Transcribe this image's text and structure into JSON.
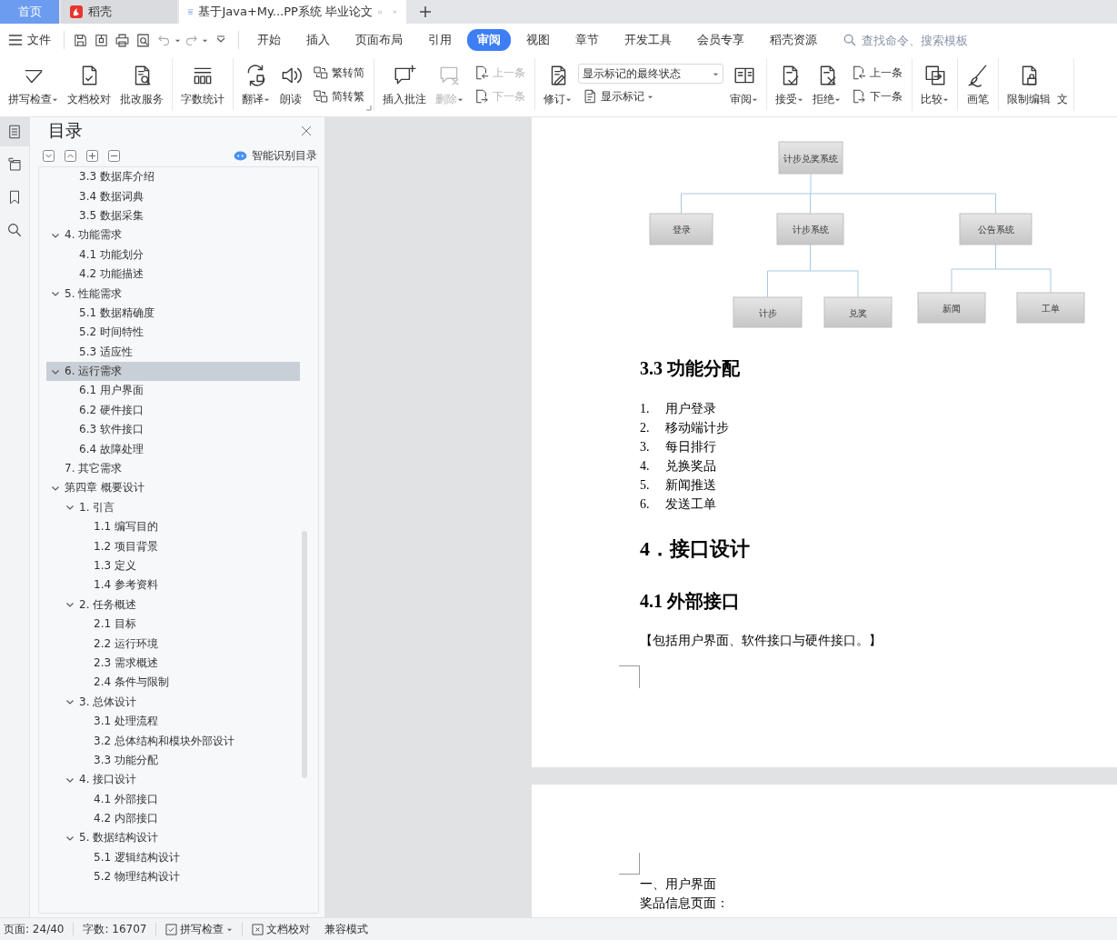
{
  "tabs": [
    {
      "label": "首页",
      "kind": "home",
      "selected": false
    },
    {
      "label": "稻壳",
      "kind": "app",
      "selected": false
    },
    {
      "label": "基于Java+My...PP系统 毕业论文",
      "kind": "document",
      "selected": true
    }
  ],
  "menu": {
    "file": "文件",
    "tabs": [
      {
        "label": "开始",
        "selected": false
      },
      {
        "label": "插入",
        "selected": false
      },
      {
        "label": "页面布局",
        "selected": false
      },
      {
        "label": "引用",
        "selected": false
      },
      {
        "label": "审阅",
        "selected": true
      },
      {
        "label": "视图",
        "selected": false
      },
      {
        "label": "章节",
        "selected": false
      },
      {
        "label": "开发工具",
        "selected": false
      },
      {
        "label": "会员专享",
        "selected": false
      },
      {
        "label": "稻壳资源",
        "selected": false
      }
    ],
    "search": {
      "placeholder": "查找命令、搜索模板"
    }
  },
  "ribbon": [
    {
      "launcher": false,
      "items": [
        {
          "kind": "large",
          "label": "拼写检查",
          "dropdown": true,
          "disabled": false
        },
        {
          "kind": "large",
          "label": "文档校对",
          "dropdown": false,
          "disabled": false
        },
        {
          "kind": "large",
          "label": "批改服务",
          "dropdown": false,
          "disabled": false
        }
      ]
    },
    {
      "launcher": false,
      "items": [
        {
          "kind": "large",
          "label": "字数统计",
          "dropdown": false,
          "disabled": false
        }
      ]
    },
    {
      "launcher": true,
      "items": [
        {
          "kind": "large",
          "label": "翻译",
          "dropdown": true,
          "disabled": false
        },
        {
          "kind": "large",
          "label": "朗读",
          "dropdown": false,
          "disabled": false
        },
        {
          "kind": "stack",
          "items": [
            {
              "kind": "small",
              "label": "繁转简",
              "dropdown": false,
              "disabled": false
            },
            {
              "kind": "small",
              "label": "简转繁",
              "dropdown": false,
              "disabled": false
            }
          ]
        }
      ]
    },
    {
      "launcher": false,
      "items": [
        {
          "kind": "large",
          "label": "插入批注",
          "dropdown": false,
          "disabled": false
        },
        {
          "kind": "large",
          "label": "删除",
          "dropdown": true,
          "disabled": true
        },
        {
          "kind": "stack",
          "items": [
            {
              "kind": "small",
              "label": "上一条",
              "dropdown": false,
              "disabled": true
            },
            {
              "kind": "small",
              "label": "下一条",
              "dropdown": false,
              "disabled": true
            }
          ]
        }
      ]
    },
    {
      "launcher": false,
      "items": [
        {
          "kind": "large",
          "label": "修订",
          "dropdown": true,
          "disabled": false
        },
        {
          "kind": "stack",
          "items": [
            {
              "kind": "select",
              "value": "显示标记的最终状态"
            },
            {
              "kind": "small",
              "label": "显示标记",
              "dropdown": true,
              "disabled": false
            }
          ]
        },
        {
          "kind": "large",
          "label": "审阅",
          "dropdown": true,
          "disabled": false
        }
      ]
    },
    {
      "launcher": false,
      "items": [
        {
          "kind": "large",
          "label": "接受",
          "dropdown": true,
          "disabled": false
        },
        {
          "kind": "large",
          "label": "拒绝",
          "dropdown": true,
          "disabled": false
        },
        {
          "kind": "stack",
          "items": [
            {
              "kind": "small",
              "label": "上一条",
              "dropdown": false,
              "disabled": false
            },
            {
              "kind": "small",
              "label": "下一条",
              "dropdown": false,
              "disabled": false
            }
          ]
        }
      ]
    },
    {
      "launcher": false,
      "items": [
        {
          "kind": "large",
          "label": "比较",
          "dropdown": true,
          "disabled": false
        }
      ]
    },
    {
      "launcher": false,
      "items": [
        {
          "kind": "large",
          "label": "画笔",
          "dropdown": false,
          "disabled": false
        }
      ]
    },
    {
      "launcher": false,
      "items": [
        {
          "kind": "large",
          "label": "限制编辑",
          "dropdown": false,
          "disabled": false
        },
        {
          "kind": "text",
          "label": "文"
        }
      ]
    }
  ],
  "nav": {
    "title": "目录",
    "smart_button": "智能识别目录",
    "toc": [
      {
        "children": [
          {
            "children": [
              {
                "label": "3.3 数据库介绍",
                "selected": false
              },
              {
                "label": "3.4 数据词典",
                "selected": false
              },
              {
                "label": "3.5 数据采集",
                "selected": false
              }
            ]
          },
          {
            "label": "4. 功能需求",
            "expanded": true,
            "selected": false,
            "children": [
              {
                "label": "4.1 功能划分",
                "selected": false
              },
              {
                "label": "4.2 功能描述",
                "selected": false
              }
            ]
          },
          {
            "label": "5. 性能需求",
            "expanded": true,
            "selected": false,
            "children": [
              {
                "label": "5.1 数据精确度",
                "selected": false
              },
              {
                "label": "5.2 时间特性",
                "selected": false
              },
              {
                "label": "5.3 适应性",
                "selected": false
              }
            ]
          },
          {
            "label": "6. 运行需求",
            "expanded": true,
            "selected": true,
            "children": [
              {
                "label": "6.1 用户界面",
                "selected": false
              },
              {
                "label": "6.2 硬件接口",
                "selected": false
              },
              {
                "label": "6.3 软件接口",
                "selected": false
              },
              {
                "label": "6.4 故障处理",
                "selected": false
              }
            ]
          },
          {
            "label": "7. 其它需求",
            "selected": false
          }
        ]
      },
      {
        "label": "第四章  概要设计",
        "expanded": true,
        "selected": false,
        "children": [
          {
            "label": "1. 引言",
            "expanded": true,
            "selected": false,
            "children": [
              {
                "label": "1.1 编写目的",
                "selected": false
              },
              {
                "label": "1.2 项目背景",
                "selected": false
              },
              {
                "label": "1.3 定义",
                "selected": false
              },
              {
                "label": "1.4 参考资料",
                "selected": false
              }
            ]
          },
          {
            "label": "2. 任务概述",
            "expanded": true,
            "selected": false,
            "children": [
              {
                "label": "2.1 目标",
                "selected": false
              },
              {
                "label": "2.2 运行环境",
                "selected": false
              },
              {
                "label": "2.3 需求概述",
                "selected": false
              },
              {
                "label": "2.4 条件与限制",
                "selected": false
              }
            ]
          },
          {
            "label": "3. 总体设计",
            "expanded": true,
            "selected": false,
            "children": [
              {
                "label": "3.1 处理流程",
                "selected": false
              },
              {
                "label": "3.2 总体结构和模块外部设计",
                "selected": false
              },
              {
                "label": "3.3 功能分配",
                "selected": false
              }
            ]
          },
          {
            "label": "4. 接口设计",
            "expanded": true,
            "selected": false,
            "children": [
              {
                "label": "4.1 外部接口",
                "selected": false
              },
              {
                "label": "4.2 内部接口",
                "selected": false
              }
            ]
          },
          {
            "label": "5. 数据结构设计",
            "expanded": true,
            "selected": false,
            "children": [
              {
                "label": "5.1 逻辑结构设计",
                "selected": false
              },
              {
                "label": "5.2 物理结构设计",
                "selected": false
              }
            ]
          }
        ]
      }
    ]
  },
  "document": {
    "diagram": {
      "label": "计步兑奖系统",
      "children": [
        {
          "label": "登录"
        },
        {
          "label": "计步系统",
          "children": [
            {
              "label": "计步"
            },
            {
              "label": "兑奖"
            }
          ]
        },
        {
          "label": "公告系统",
          "children": [
            {
              "label": "新闻"
            },
            {
              "label": "工单"
            }
          ]
        }
      ]
    },
    "heading_1": "3.3 功能分配",
    "list": [
      {
        "number": "1.",
        "text": "用户登录"
      },
      {
        "number": "2.",
        "text": "移动端计步"
      },
      {
        "number": "3.",
        "text": "每日排行"
      },
      {
        "number": "4.",
        "text": "兑换奖品"
      },
      {
        "number": "5.",
        "text": "新闻推送"
      },
      {
        "number": "6.",
        "text": "发送工单"
      }
    ],
    "heading_2": "4．接口设计",
    "heading_3": "4.1 外部接口",
    "paragraph": "【包括用户界面、软件接口与硬件接口。】",
    "page_2": [
      "一、用户界面",
      "奖品信息页面："
    ]
  },
  "status_bar": {
    "page": "页面: 24/40",
    "words": "字数: 16707",
    "spell": "拼写检查",
    "proof": "文档校对",
    "mode": "兼容模式"
  }
}
